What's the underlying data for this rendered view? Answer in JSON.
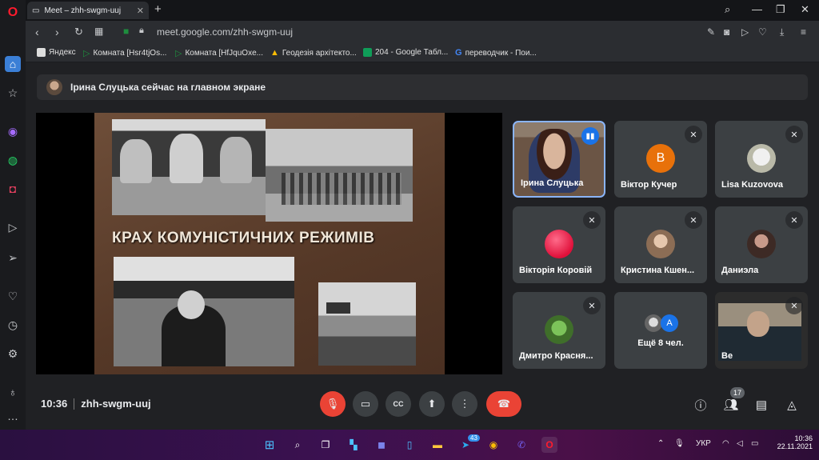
{
  "browser": {
    "tab_title": "Meet – zhh-swgm-uuj",
    "url": "meet.google.com/zhh-swgm-uuj",
    "bookmarks": [
      {
        "label": "Яндекс"
      },
      {
        "label": "Комната [Hsr4tjOs..."
      },
      {
        "label": "Комната [HfJquOxe..."
      },
      {
        "label": "Геодезія архітекто..."
      },
      {
        "label": "204 - Google Табл..."
      },
      {
        "label": "переводчик - Пои..."
      }
    ]
  },
  "meet": {
    "banner_text": "Ірина Слуцька сейчас на главном экране",
    "slide_title": "КРАХ КОМУНІСТИЧНИХ РЕЖИМІВ",
    "time": "10:36",
    "meeting_code": "zhh-swgm-uuj",
    "participant_count": "17",
    "participants": [
      {
        "name": "Ірина Слуцька",
        "speaking": true
      },
      {
        "name": "Віктор Кучер",
        "initial": "В",
        "color": "#e8710a"
      },
      {
        "name": "Lisa Kuzovova"
      },
      {
        "name": "Вікторія Коровій"
      },
      {
        "name": "Кристина Кшен..."
      },
      {
        "name": "Даниэла"
      },
      {
        "name": "Дмитро Красня..."
      },
      {
        "name": "Ещё 8 чел.",
        "initial": "A"
      },
      {
        "name": "Ве"
      }
    ]
  },
  "taskbar": {
    "telegram_badge": "43",
    "lang": "УКР",
    "clock_time": "10:36",
    "clock_date": "22.11.2021"
  },
  "colors": {
    "end_call": "#ea4335",
    "mic_off": "#ea4335",
    "speaking_border": "#8ab4f8",
    "opera_red": "#ff1b2d"
  }
}
